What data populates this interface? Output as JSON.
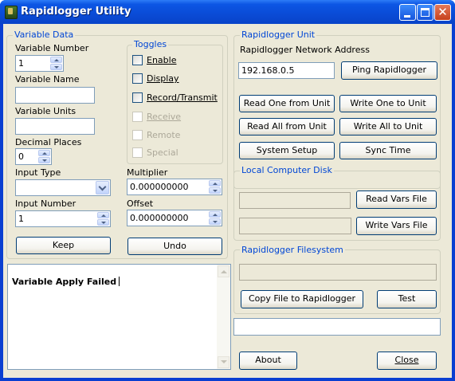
{
  "window": {
    "title": "Rapidlogger Utility"
  },
  "variable_data": {
    "legend": "Variable Data",
    "number_label": "Variable Number",
    "number_value": "1",
    "name_label": "Variable Name",
    "name_value": "",
    "units_label": "Variable Units",
    "units_value": "",
    "decimal_label": "Decimal Places",
    "decimal_value": "0",
    "input_type_label": "Input Type",
    "input_type_value": "",
    "input_number_label": "Input Number",
    "input_number_value": "1",
    "multiplier_label": "Multiplier",
    "multiplier_value": "0.000000000",
    "offset_label": "Offset",
    "offset_value": "0.000000000",
    "keep_label": "Keep",
    "undo_label": "Undo"
  },
  "toggles": {
    "legend": "Toggles",
    "items": [
      {
        "label": "Enable",
        "checked": false,
        "enabled": true
      },
      {
        "label": "Display",
        "checked": false,
        "enabled": true
      },
      {
        "label": "Record/Transmit",
        "checked": false,
        "enabled": true
      },
      {
        "label": "Receive",
        "checked": false,
        "enabled": false
      },
      {
        "label": "Remote",
        "checked": false,
        "enabled": false
      },
      {
        "label": "Special",
        "checked": false,
        "enabled": false
      }
    ]
  },
  "log": {
    "text": "Variable Apply Failed"
  },
  "unit": {
    "legend": "Rapidlogger Unit",
    "address_label": "Rapidlogger Network Address",
    "address_value": "192.168.0.5",
    "ping_label": "Ping Rapidlogger",
    "read_one_label": "Read One from Unit",
    "write_one_label": "Write One to Unit",
    "read_all_label": "Read All from Unit",
    "write_all_label": "Write All to Unit",
    "system_setup_label": "System Setup",
    "sync_time_label": "Sync Time"
  },
  "local_disk": {
    "legend": "Local Computer Disk",
    "read_path": "",
    "write_path": "",
    "read_label": "Read Vars File",
    "write_label": "Write Vars File"
  },
  "filesystem": {
    "legend": "Rapidlogger Filesystem",
    "path": "",
    "copy_label": "Copy File to Rapidlogger",
    "test_label": "Test"
  },
  "status": {
    "text": ""
  },
  "footer": {
    "about_label": "About",
    "close_label": "Close"
  }
}
